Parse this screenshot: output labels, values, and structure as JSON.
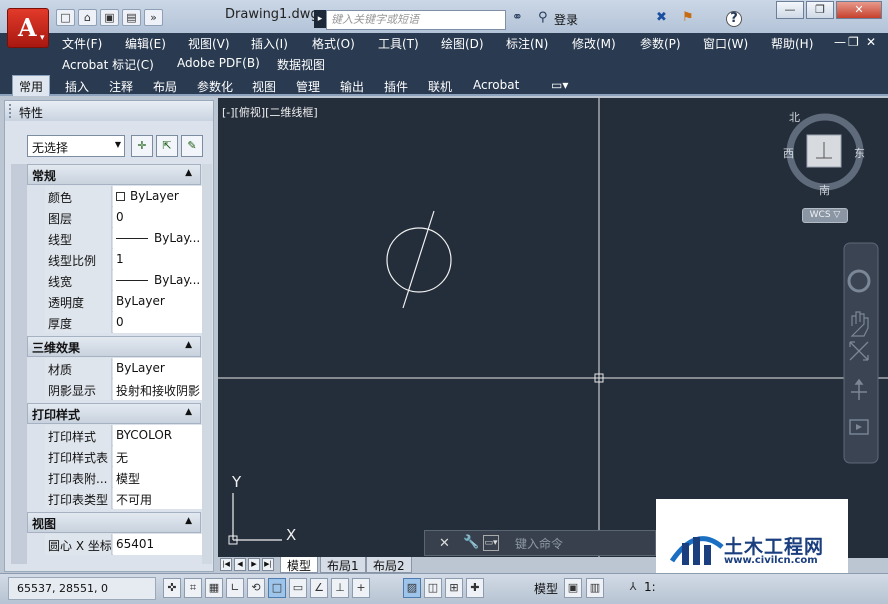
{
  "app": {
    "logo_text": "A",
    "logo_sub": "▾",
    "doc_title": "Drawing1.dwg"
  },
  "quick_access": [
    "□",
    "⌂",
    "▣",
    "▤",
    "»"
  ],
  "search": {
    "arrow": "▸",
    "placeholder": "键入关键字或短语"
  },
  "header_icons": {
    "binoculars": "⚭",
    "user": "⚲",
    "exchange": "✖",
    "apps": "⚑",
    "help": "?"
  },
  "user": {
    "login": "登录"
  },
  "window_controls": {
    "minimize": "—",
    "restore": "❐",
    "close": "✕"
  },
  "menu": {
    "items": [
      "文件(F)",
      "编辑(E)",
      "视图(V)",
      "插入(I)",
      "格式(O)",
      "工具(T)",
      "绘图(D)",
      "标注(N)",
      "修改(M)",
      "参数(P)",
      "窗口(W)",
      "帮助(H)"
    ],
    "mdi": {
      "minimize": "—",
      "restore": "❐",
      "close": "✕"
    }
  },
  "menu2": {
    "items": [
      "Acrobat 标记(C)",
      "Adobe PDF(B)",
      "数据视图"
    ]
  },
  "ribbon_tabs": [
    "常用",
    "插入",
    "注释",
    "布局",
    "参数化",
    "视图",
    "管理",
    "输出",
    "插件",
    "联机",
    "Acrobat",
    "▭▾"
  ],
  "properties": {
    "title": "特性",
    "selection": "无选择",
    "combo_arrow": "▼",
    "buttons": [
      "✛",
      "⇱",
      "✎"
    ],
    "sections": [
      {
        "title": "常规",
        "rows": [
          {
            "key": "颜色",
            "value": "ByLayer",
            "swatch": true
          },
          {
            "key": "图层",
            "value": "0"
          },
          {
            "key": "线型",
            "value": "ByLay...",
            "line": true
          },
          {
            "key": "线型比例",
            "value": "1"
          },
          {
            "key": "线宽",
            "value": "ByLay...",
            "line": true
          },
          {
            "key": "透明度",
            "value": "ByLayer"
          },
          {
            "key": "厚度",
            "value": "0"
          }
        ]
      },
      {
        "title": "三维效果",
        "rows": [
          {
            "key": "材质",
            "value": "ByLayer"
          },
          {
            "key": "阴影显示",
            "value": "投射和接收阴影"
          }
        ]
      },
      {
        "title": "打印样式",
        "rows": [
          {
            "key": "打印样式",
            "value": "BYCOLOR"
          },
          {
            "key": "打印样式表",
            "value": "无"
          },
          {
            "key": "打印表附...",
            "value": "模型"
          },
          {
            "key": "打印表类型",
            "value": "不可用"
          }
        ]
      },
      {
        "title": "视图",
        "rows": [
          {
            "key": "圆心 X 坐标",
            "value": "65401"
          }
        ]
      }
    ],
    "collapse_icon": "▲"
  },
  "viewport": {
    "label": "[-][俯视][二维线框]"
  },
  "viewcube": {
    "north": "北",
    "south": "南",
    "east": "东",
    "west": "西",
    "wcs": "WCS ▽"
  },
  "ucs": {
    "x": "X",
    "y": "Y"
  },
  "command": {
    "close": "✕",
    "wrench": "🔧",
    "prompt": "▭▾",
    "placeholder": "键入命令"
  },
  "layout_tabs": {
    "nav": [
      "|◀",
      "◀",
      "▶",
      "▶|"
    ],
    "tabs": [
      "模型",
      "布局1",
      "布局2"
    ]
  },
  "status": {
    "coords": "65537, 28551, 0",
    "model": "模型",
    "buttons": [
      "✜",
      "⌗",
      "▦",
      "∟",
      "⟲",
      "□",
      "▭",
      "∠",
      "⊥",
      "+",
      "▨",
      "◫",
      "⊞",
      "✚"
    ],
    "right": [
      "▣",
      "▥",
      "⅄",
      "1:"
    ]
  },
  "watermark": {
    "text": "土木工程网",
    "url": "www.civilcn.com"
  }
}
